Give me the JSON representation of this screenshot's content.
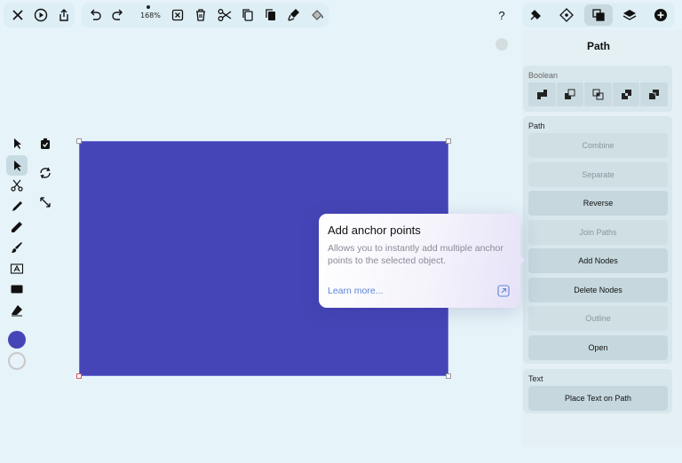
{
  "toolbar": {
    "zoom_label": "168%",
    "left_icons": [
      "close-icon",
      "play-icon",
      "share-icon"
    ],
    "edit_icons": [
      "undo-icon",
      "redo-icon"
    ],
    "action_icons": [
      "deselect-icon",
      "trash-icon",
      "scissors-icon",
      "copy-icon",
      "paste-icon",
      "paint-brush-icon",
      "fill-bucket-icon"
    ],
    "right_icons": [
      "help-icon",
      "brush-settings-icon",
      "node-icon",
      "boolean-icon",
      "layers-icon",
      "add-icon"
    ]
  },
  "left_tools": [
    "select-icon",
    "direct-select-icon",
    "scissors-icon",
    "pen-icon",
    "pencil-icon",
    "brush-icon",
    "text-icon",
    "rectangle-icon",
    "eraser-icon"
  ],
  "fill_color": "#4645b7",
  "panel": {
    "title": "Path",
    "boolean_label": "Boolean",
    "path_label": "Path",
    "path_buttons": [
      {
        "label": "Combine",
        "enabled": false
      },
      {
        "label": "Separate",
        "enabled": false
      },
      {
        "label": "Reverse",
        "enabled": true
      },
      {
        "label": "Join Paths",
        "enabled": false
      },
      {
        "label": "Add Nodes",
        "enabled": true
      },
      {
        "label": "Delete Nodes",
        "enabled": true
      },
      {
        "label": "Outline",
        "enabled": false
      },
      {
        "label": "Open",
        "enabled": true
      }
    ],
    "text_label": "Text",
    "text_button": "Place Text on Path"
  },
  "tooltip": {
    "title": "Add anchor points",
    "description": "Allows you to instantly add multiple anchor points to the selected object.",
    "link": "Learn more..."
  },
  "help_glyph": "?"
}
